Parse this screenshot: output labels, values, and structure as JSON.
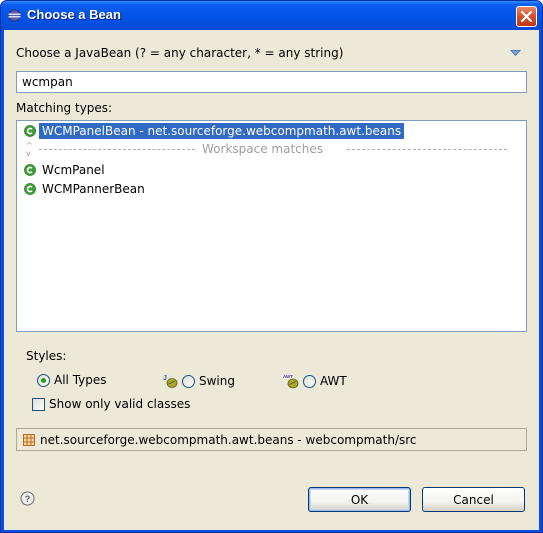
{
  "window": {
    "title": "Choose a Bean",
    "icon": "eclipse-icon",
    "close_icon": "close-icon"
  },
  "dialog": {
    "prompt": "Choose a JavaBean (? = any character, * = any string)",
    "menu_icon": "view-menu-arrow-icon",
    "filter": {
      "value": "wcmpan",
      "placeholder": ""
    },
    "matching_label": "Matching types:",
    "matches": [
      {
        "label": "WCMPanelBean - net.sourceforge.webcompmath.awt.beans",
        "icon": "class-icon",
        "selected": true
      },
      {
        "label": "Workspace matches",
        "separator": true
      },
      {
        "label": "WcmPanel",
        "icon": "class-icon",
        "selected": false
      },
      {
        "label": "WCMPannerBean",
        "icon": "class-icon",
        "selected": false
      }
    ],
    "styles": {
      "label": "Styles:",
      "options": [
        {
          "label": "All Types",
          "checked": true,
          "icon": ""
        },
        {
          "label": "Swing",
          "checked": false,
          "icon": "swing-bean-icon"
        },
        {
          "label": "AWT",
          "checked": false,
          "icon": "awt-bean-icon"
        }
      ],
      "awt_badge": "AWT",
      "swing_badge": "J"
    },
    "show_valid": {
      "label": "Show only valid classes",
      "checked": false
    },
    "status": {
      "icon": "package-icon",
      "text": "net.sourceforge.webcompmath.awt.beans - webcompmath/src"
    },
    "help_icon": "help-icon",
    "buttons": {
      "ok": "OK",
      "cancel": "Cancel"
    }
  },
  "colors": {
    "titlebar": "#0450e0",
    "selection": "#316ac5",
    "dialog_bg": "#ece9d8",
    "class_icon": "#3fa037"
  }
}
